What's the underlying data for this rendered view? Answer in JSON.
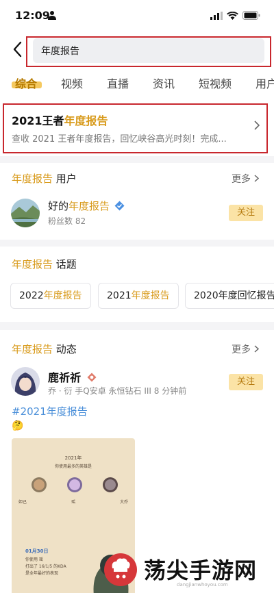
{
  "status_bar": {
    "time": "12:09"
  },
  "search": {
    "query": "年度报告"
  },
  "tabs": [
    "综合",
    "视频",
    "直播",
    "资讯",
    "短视频",
    "用户"
  ],
  "report_card": {
    "title_prefix": "2021王者",
    "title_highlight": "年度报告",
    "description": "查收 2021 王者年度报告，回忆峡谷高光时刻！完成..."
  },
  "users_section": {
    "title_highlight": "年度报告",
    "title_suffix": "用户",
    "more_label": "更多",
    "user": {
      "name_prefix": "好的",
      "name_highlight": "年度报告",
      "fans": "粉丝数 82",
      "follow_label": "关注"
    }
  },
  "topics_section": {
    "title_highlight": "年度报告",
    "title_suffix": "话题",
    "chips": [
      {
        "prefix": "2022",
        "highlight": "年度报告",
        "suffix": ""
      },
      {
        "prefix": "2021",
        "highlight": "年度报告",
        "suffix": ""
      },
      {
        "prefix": "2020年度回忆报告",
        "highlight": "",
        "suffix": ""
      }
    ]
  },
  "posts_section": {
    "title_highlight": "年度报告",
    "title_suffix": "动态",
    "more_label": "更多",
    "post": {
      "author": "鹿祈祈",
      "meta": "乔 · 衍 手Q安卓 永恒钻石 III   8 分钟前",
      "follow_label": "关注",
      "hashtag": "#2021年度报告",
      "emoji": "🤔",
      "poster": {
        "year": "2021年",
        "subtitle": "你使用最多的英雄是",
        "heroes": [
          "妲己",
          "瑶",
          "大乔"
        ],
        "date": "01月30日",
        "line1": "你使用  瑶",
        "line2": "打出了 16/1/5 的KDA",
        "line3": "是全年最好的表现"
      }
    },
    "watermark": {
      "text": "荡尖手游网",
      "sub": "dangjianwhoyou.com"
    }
  }
}
